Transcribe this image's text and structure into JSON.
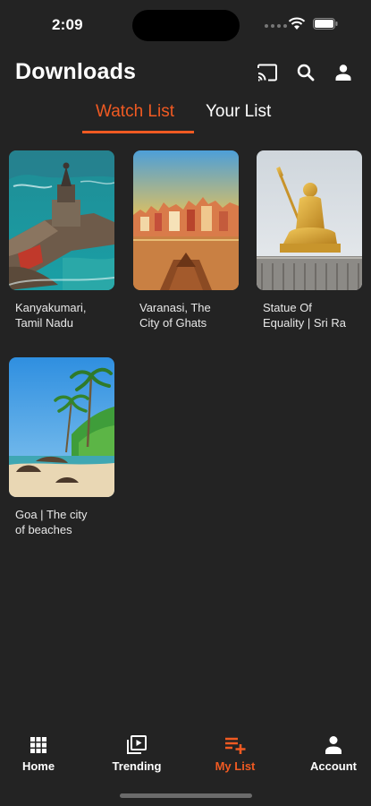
{
  "status_bar": {
    "time": "2:09"
  },
  "header": {
    "title": "Downloads"
  },
  "tabs": [
    {
      "label": "Watch List",
      "active": true
    },
    {
      "label": "Your List",
      "active": false
    }
  ],
  "items": [
    {
      "title": "Kanyakumari,\nTamil Nadu",
      "image": "kanyakumari-statue-island"
    },
    {
      "title": "Varanasi, The\nCity of Ghats",
      "image": "varanasi-ghats-boat"
    },
    {
      "title": "Statue Of\nEquality | Sri Ra",
      "image": "golden-statue-of-equality"
    },
    {
      "title": "Goa | The city\nof beaches",
      "image": "goa-beach-palms"
    }
  ],
  "bottom_nav": [
    {
      "label": "Home",
      "icon": "grid-icon"
    },
    {
      "label": "Trending",
      "icon": "play-library-icon"
    },
    {
      "label": "My List",
      "icon": "playlist-add-icon",
      "active": true
    },
    {
      "label": "Account",
      "icon": "person-icon"
    }
  ],
  "colors": {
    "accent": "#f05a22",
    "background": "#232323",
    "text": "#ffffff"
  }
}
